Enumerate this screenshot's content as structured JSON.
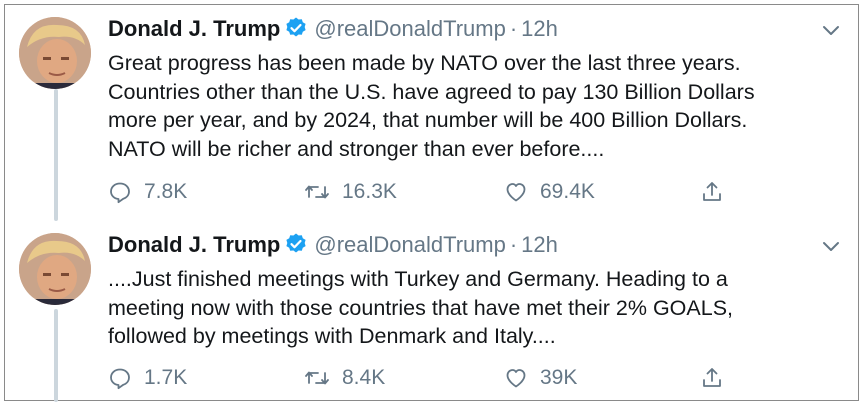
{
  "tweets": [
    {
      "name": "Donald J. Trump",
      "handle": "@realDonaldTrump",
      "separator": "·",
      "time": "12h",
      "text": "Great progress has been made by NATO over the last three years.\nCountries other than the U.S. have agreed to pay 130 Billion Dollars\nmore per year, and by 2024, that number will be 400 Billion Dollars.\nNATO will be richer and stronger than ever before....",
      "replies": "7.8K",
      "retweets": "16.3K",
      "likes": "69.4K"
    },
    {
      "name": "Donald J. Trump",
      "handle": "@realDonaldTrump",
      "separator": "·",
      "time": "12h",
      "text": "....Just finished meetings with Turkey and Germany. Heading to a\nmeeting now with those countries that have met their 2% GOALS,\nfollowed by meetings with Denmark and Italy....",
      "replies": "1.7K",
      "retweets": "8.4K",
      "likes": "39K"
    }
  ],
  "icons": {
    "verified": "verified-badge-icon",
    "caret": "chevron-down-icon",
    "reply": "reply-icon",
    "retweet": "retweet-icon",
    "like": "heart-icon",
    "share": "share-icon"
  },
  "colors": {
    "verified": "#1da1f2",
    "muted": "#657786",
    "thread_line": "#ccd6dd",
    "text": "#14171a"
  }
}
